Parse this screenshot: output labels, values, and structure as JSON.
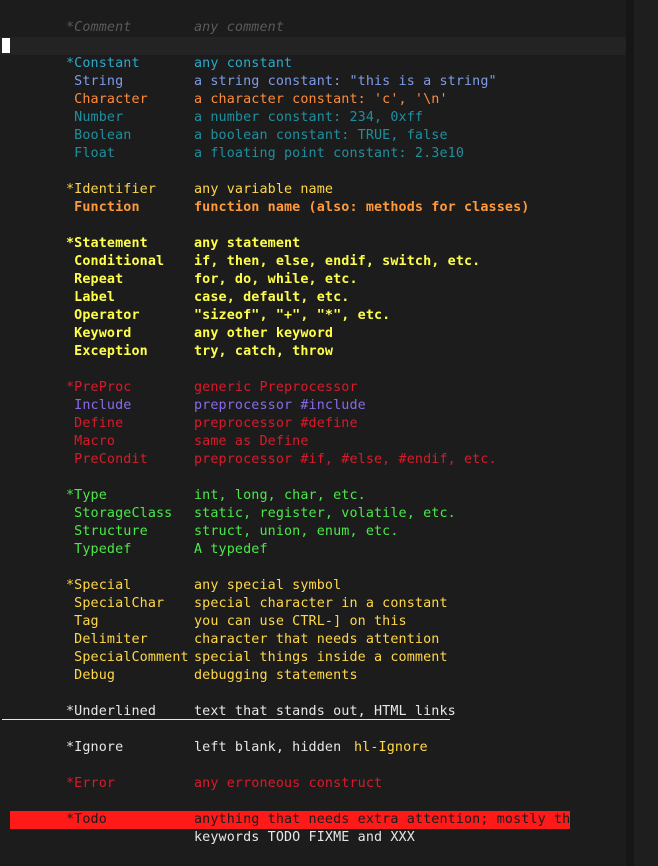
{
  "editor": {
    "lines": [
      {
        "name": "*Comment",
        "desc": "any comment",
        "name_color": "#5a5a5a",
        "desc_color": "#5a5a5a",
        "italic": true
      },
      {
        "name": "*Constant",
        "desc": "any constant",
        "name_color": "#2aa9c9",
        "desc_color": "#2aa9c9"
      },
      {
        "name": " String",
        "desc": "a string constant: \"this is a string\"",
        "name_color": "#7f9be8",
        "desc_color": "#7f9be8"
      },
      {
        "name": " Character",
        "desc": "a character constant: 'c', '\\n'",
        "name_color": "#ff8c3a",
        "desc_color": "#ff8c3a"
      },
      {
        "name": " Number",
        "desc": "a number constant: 234, 0xff",
        "name_color": "#1f8f9e",
        "desc_color": "#1f8f9e"
      },
      {
        "name": " Boolean",
        "desc": "a boolean constant: TRUE, false",
        "name_color": "#1f8f9e",
        "desc_color": "#1f8f9e"
      },
      {
        "name": " Float",
        "desc": "a floating point constant: 2.3e10",
        "name_color": "#1f8f9e",
        "desc_color": "#1f8f9e"
      },
      {
        "name": "*Identifier",
        "desc": "any variable name",
        "name_color": "#ffd84a",
        "desc_color": "#ffd84a"
      },
      {
        "name": " Function",
        "desc": "function name (also: methods for classes)",
        "name_color": "#ff9a3a",
        "desc_color": "#ff9a3a",
        "bold": true
      },
      {
        "name": "*Statement",
        "desc": "any statement",
        "name_color": "#ffff4a",
        "desc_color": "#ffff4a",
        "bold": true
      },
      {
        "name": " Conditional",
        "desc": "if, then, else, endif, switch, etc.",
        "name_color": "#ffff4a",
        "desc_color": "#ffff4a",
        "bold": true
      },
      {
        "name": " Repeat",
        "desc": "for, do, while, etc.",
        "name_color": "#ffff4a",
        "desc_color": "#ffff4a",
        "bold": true
      },
      {
        "name": " Label",
        "desc": "case, default, etc.",
        "name_color": "#ffff4a",
        "desc_color": "#ffff4a",
        "bold": true
      },
      {
        "name": " Operator",
        "desc": "\"sizeof\", \"+\", \"*\", etc.",
        "name_color": "#ffff4a",
        "desc_color": "#ffff4a",
        "bold": true
      },
      {
        "name": " Keyword",
        "desc": "any other keyword",
        "name_color": "#ffff4a",
        "desc_color": "#ffff4a",
        "bold": true
      },
      {
        "name": " Exception",
        "desc": "try, catch, throw",
        "name_color": "#ffff4a",
        "desc_color": "#ffff4a",
        "bold": true
      },
      {
        "name": "*PreProc",
        "desc": "generic Preprocessor",
        "name_color": "#d81b2a",
        "desc_color": "#d81b2a"
      },
      {
        "name": " Include",
        "desc": "preprocessor #include",
        "name_color": "#8a6ae8",
        "desc_color": "#8a6ae8"
      },
      {
        "name": " Define",
        "desc": "preprocessor #define",
        "name_color": "#d81b2a",
        "desc_color": "#d81b2a"
      },
      {
        "name": " Macro",
        "desc": "same as Define",
        "name_color": "#d81b2a",
        "desc_color": "#d81b2a"
      },
      {
        "name": " PreCondit",
        "desc": "preprocessor #if, #else, #endif, etc.",
        "name_color": "#d81b2a",
        "desc_color": "#d81b2a"
      },
      {
        "name": "*Type",
        "desc": "int, long, char, etc.",
        "name_color": "#4ae84a",
        "desc_color": "#4ae84a"
      },
      {
        "name": " StorageClass",
        "desc": "static, register, volatile, etc.",
        "name_color": "#4ae84a",
        "desc_color": "#4ae84a"
      },
      {
        "name": " Structure",
        "desc": "struct, union, enum, etc.",
        "name_color": "#4ae84a",
        "desc_color": "#4ae84a"
      },
      {
        "name": " Typedef",
        "desc": "A typedef",
        "name_color": "#4ae84a",
        "desc_color": "#4ae84a"
      },
      {
        "name": "*Special",
        "desc": "any special symbol",
        "name_color": "#ffd84a",
        "desc_color": "#ffd84a"
      },
      {
        "name": " SpecialChar",
        "desc": "special character in a constant",
        "name_color": "#ffd84a",
        "desc_color": "#ffd84a"
      },
      {
        "name": " Tag",
        "desc": "you can use CTRL-] on this",
        "name_color": "#ffd84a",
        "desc_color": "#ffd84a"
      },
      {
        "name": " Delimiter",
        "desc": "character that needs attention",
        "name_color": "#ffd84a",
        "desc_color": "#ffd84a"
      },
      {
        "name": " SpecialComment",
        "desc": "special things inside a comment",
        "name_color": "#ffd84a",
        "desc_color": "#ffd84a"
      },
      {
        "name": " Debug",
        "desc": "debugging statements",
        "name_color": "#ffd84a",
        "desc_color": "#ffd84a"
      },
      {
        "name": "*Underlined",
        "desc": "text that stands out, HTML links",
        "name_color": "#e6e6e6",
        "desc_color": "#e6e6e6"
      },
      {
        "name": "*Ignore",
        "desc": "left blank, hidden",
        "extra": "hl-Ignore",
        "name_color": "#e6e6e6",
        "desc_color": "#e6e6e6",
        "extra_color": "#ffd84a"
      },
      {
        "name": "*Error",
        "desc": "any erroneous construct",
        "name_color": "#d81b2a",
        "desc_color": "#d81b2a"
      },
      {
        "name": "*Todo",
        "desc": "anything that needs extra attention; mostly the",
        "name_color": "#1c1c1c",
        "desc_color": "#1c1c1c"
      },
      {
        "name": "",
        "desc": "keywords TODO FIXME and XXX",
        "name_color": "#e6e6e6",
        "desc_color": "#e6e6e6"
      }
    ]
  }
}
